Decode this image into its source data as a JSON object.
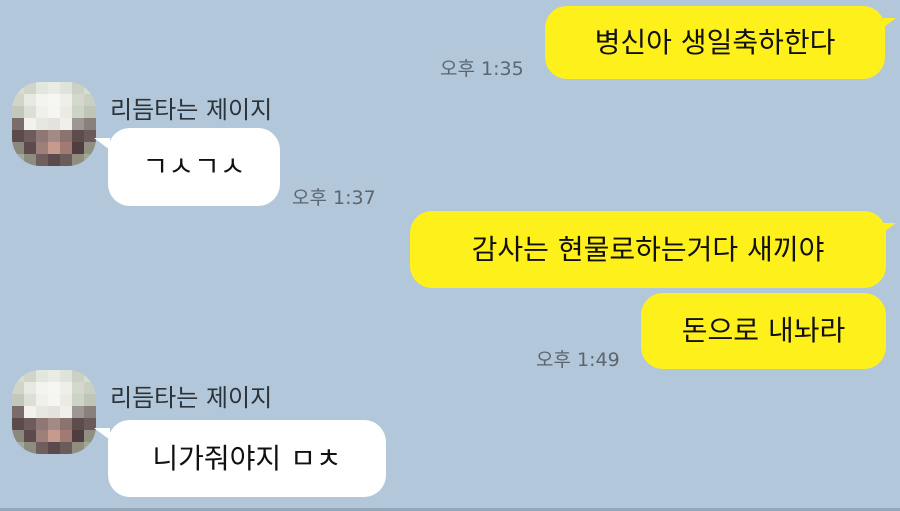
{
  "colors": {
    "background": "#b2c7d9",
    "my_bubble": "#fef01b",
    "their_bubble": "#ffffff",
    "timestamp_text": "#5b6670"
  },
  "messages": [
    {
      "from": "me",
      "text": "병신아 생일축하한다",
      "time": "오후 1:35"
    },
    {
      "from": "them",
      "sender": "리듬타는 제이지",
      "text": "ㄱㅅㄱㅅ",
      "time": "오후 1:37"
    },
    {
      "from": "me",
      "text": "감사는 현물로하는거다 새끼야"
    },
    {
      "from": "me",
      "text": "돈으로 내놔라",
      "time": "오후 1:49"
    },
    {
      "from": "them",
      "sender": "리듬타는 제이지",
      "text": "니가줘야지 ㅁㅊ"
    }
  ],
  "avatar": {
    "icon": "pixelated-profile-avatar",
    "pixels": [
      "#d9ddd0",
      "#cfd6c7",
      "#e2e6dc",
      "#e9ece4",
      "#dfe4db",
      "#cbd2c4",
      "#d6dccf",
      "#cfd6c8",
      "#e6e9e1",
      "#f3f3ef",
      "#f6f6f2",
      "#eeefe9",
      "#d2d8cb",
      "#c9d0c2",
      "#c2c9b9",
      "#dbdfd6",
      "#f0f0eb",
      "#f5f5f1",
      "#e9ebe4",
      "#cdd3c6",
      "#bfc6b6",
      "#7b6b6a",
      "#f2f1ec",
      "#e7e6e1",
      "#e4e2dc",
      "#f0efea",
      "#9e9694",
      "#8a7f7d",
      "#5b4a4c",
      "#6e5c5d",
      "#8f7775",
      "#a38a85",
      "#8b7470",
      "#5e4c4d",
      "#6a5a5a",
      "#8a8a7c",
      "#5c4a4c",
      "#9e7f79",
      "#c79a8e",
      "#a07a73",
      "#4f3d40",
      "#8f9080",
      "#a4a996",
      "#8c8d7e",
      "#6f5e5d",
      "#5a4a4b",
      "#6b5b5a",
      "#8e8f80",
      "#a3a895"
    ]
  }
}
